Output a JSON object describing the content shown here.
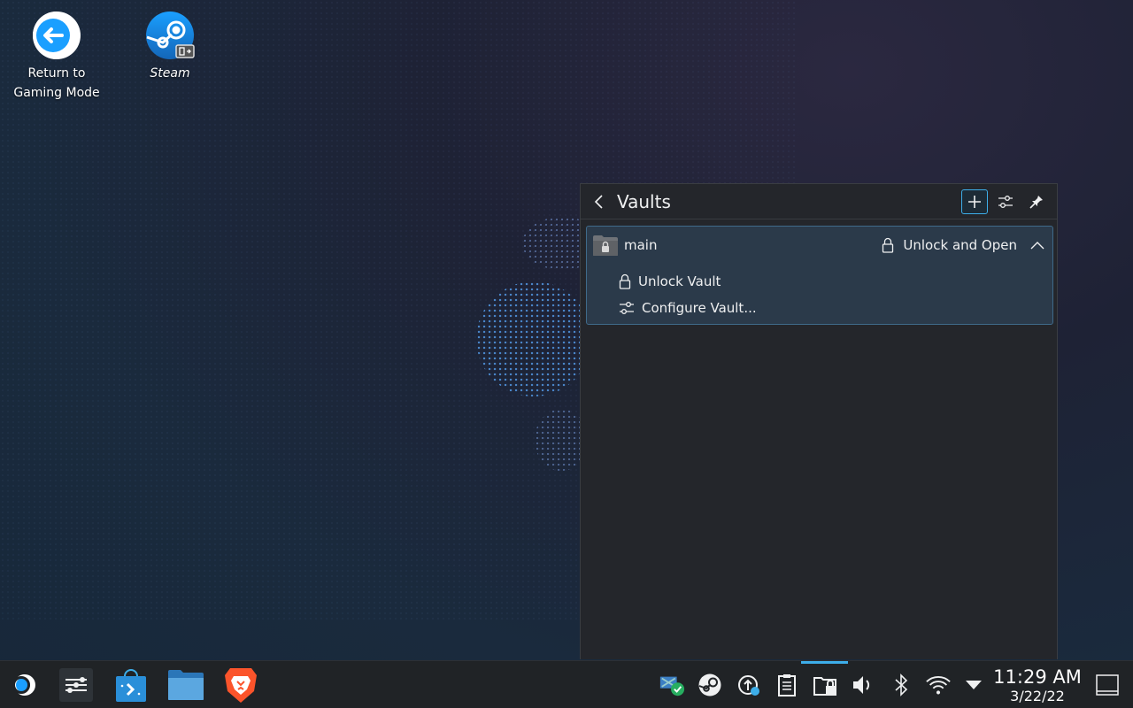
{
  "desktop": {
    "icons": [
      {
        "label_line1": "Return to",
        "label_line2": "Gaming Mode",
        "icon": "return-arrow-icon"
      },
      {
        "label_line1": "Steam",
        "label_line2": "",
        "icon": "steam-icon"
      }
    ]
  },
  "vaults_panel": {
    "title": "Vaults",
    "header_buttons": [
      "add-icon",
      "configure-icon",
      "pin-icon"
    ],
    "vault": {
      "name": "main",
      "primary_action": "Unlock and Open",
      "actions": [
        "Unlock Vault",
        "Configure Vault..."
      ]
    }
  },
  "taskbar": {
    "apps": [
      "steamos-icon",
      "system-settings-icon",
      "discover-store-icon",
      "file-manager-icon",
      "brave-browser-icon"
    ],
    "tray": [
      "update-status-icon",
      "steam-tray-icon",
      "software-updates-icon",
      "clipboard-icon",
      "vault-tray-icon",
      "volume-icon",
      "bluetooth-icon",
      "wifi-icon",
      "tray-expand-icon"
    ],
    "clock": {
      "time": "11:29 AM",
      "date": "3/22/22"
    }
  },
  "colors": {
    "accent": "#3daee9",
    "panel_bg": "#24262b",
    "selected_item_bg": "#2b3a4a",
    "taskbar_bg": "#202326",
    "brave_orange": "#fb542b"
  }
}
